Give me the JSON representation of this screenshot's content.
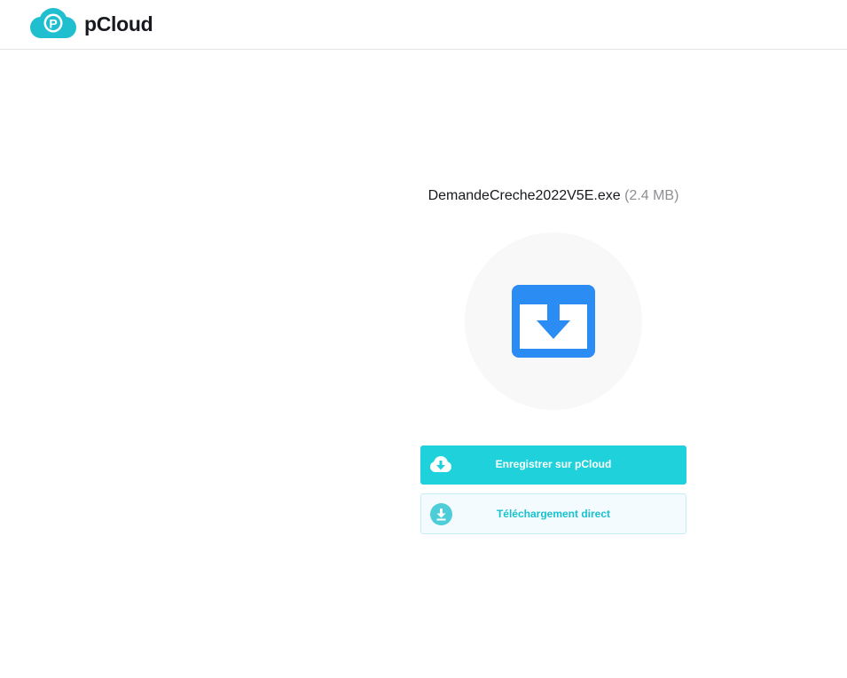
{
  "brand": {
    "name": "pCloud",
    "logo_letter": "P",
    "logo_color": "#1fbfd0"
  },
  "file": {
    "name": "DemandeCreche2022V5E.exe",
    "size": "(2.4 MB)",
    "preview_icon": "download-box-icon",
    "icon_color": "#2b8df4"
  },
  "actions": {
    "save_label": "Enregistrer sur pCloud",
    "save_icon": "cloud-download-icon",
    "save_color": "#1fd1db",
    "direct_label": "Téléchargement direct",
    "direct_icon": "circle-download-icon",
    "direct_color": "#17c2cf"
  }
}
